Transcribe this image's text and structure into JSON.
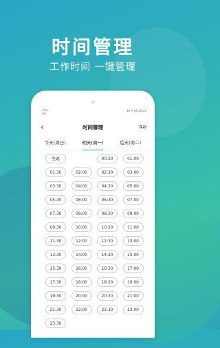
{
  "headline": "时间管理",
  "subhead": "工作时间 一键管理",
  "status": {
    "left_top": "4Ga",
    "left_bottom": "4G",
    "right": "10 ⁕ 95 20:43"
  },
  "nav": {
    "title": "时间管理",
    "save_label": "保存"
  },
  "tabs": [
    "今天(周日)",
    "明天(周一)",
    "后天(周二)"
  ],
  "active_tab": 1,
  "slots": [
    "全选",
    "00:30",
    "01:00",
    "01:30",
    "02:00",
    "02:30",
    "03:00",
    "03:30",
    "04:00",
    "04:30",
    "05:00",
    "05:30",
    "06:00",
    "06:30",
    "07:00",
    "07:30",
    "08:00",
    "08:30",
    "09:00",
    "09:30",
    "10:00",
    "10:30",
    "11:00",
    "11:30",
    "12:00",
    "12:30",
    "13:00",
    "13:30",
    "14:00",
    "14:30",
    "15:00",
    "15:30",
    "16:00",
    "16:30",
    "17:00",
    "17:30",
    "18:00",
    "18:30",
    "19:00",
    "19:30",
    "20:00",
    "20:30",
    "21:00",
    "21:30",
    "22:00",
    "22:30",
    "23:00",
    "23:30"
  ]
}
